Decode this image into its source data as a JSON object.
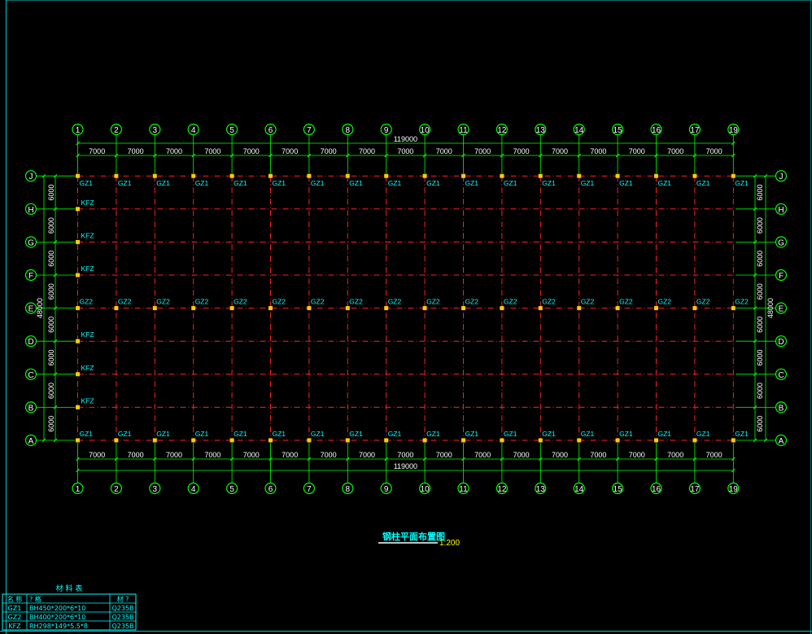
{
  "drawing": {
    "title": "钢柱平面布置图",
    "scale": "1:200",
    "colors": {
      "background": "#000000",
      "gridline": "#ff2020",
      "dimension": "#00ff00",
      "axis_bubble": "#00ff00",
      "column_label": "#00ffff",
      "column": "#ffcc00",
      "frame": "#00c8c8",
      "table": "#00ffff",
      "title": "#00ffff",
      "dim_text": "#ffffff"
    }
  },
  "axes": {
    "columns": [
      "1",
      "2",
      "3",
      "4",
      "5",
      "6",
      "7",
      "8",
      "9",
      "10",
      "11",
      "12",
      "13",
      "14",
      "15",
      "16",
      "17",
      "19"
    ],
    "rows_bottom_to_top": [
      "A",
      "B",
      "C",
      "D",
      "E",
      "F",
      "G",
      "H",
      "J"
    ]
  },
  "dimensions": {
    "bay_x": "7000",
    "total_x": "119000",
    "bay_y": "6000",
    "total_y": "48000"
  },
  "column_labels": {
    "row_J": "GZ1",
    "row_E": "GZ2",
    "row_A": "GZ1",
    "gable": "KFZ"
  },
  "materials_table": {
    "title": "材 料 表",
    "headers": [
      "名 称",
      "? 格",
      "材 ?"
    ],
    "rows": [
      [
        "GZ1",
        "BH450*200*6*10",
        "Q235B"
      ],
      [
        "GZ2",
        "BH400*200*6*10",
        "Q235B"
      ],
      [
        "KFZ",
        "RH298*149*5.5*8",
        "Q235B"
      ]
    ]
  }
}
